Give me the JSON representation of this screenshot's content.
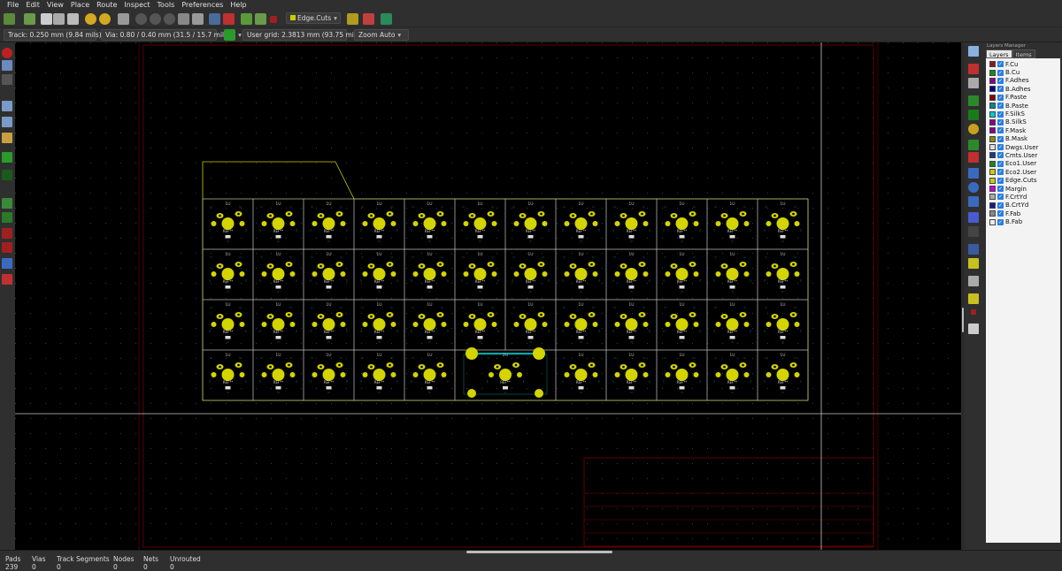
{
  "menu": [
    "File",
    "Edit",
    "View",
    "Place",
    "Route",
    "Inspect",
    "Tools",
    "Preferences",
    "Help"
  ],
  "toolbar": {
    "active_layer": "Edge.Cuts",
    "track": "Track: 0.250 mm (9.84 mils) *",
    "via": "Via: 0.80 / 0.40 mm (31.5 / 15.7 mils) *",
    "grid": "User grid: 2.3813 mm (93.75 mils)",
    "zoom": "Zoom Auto"
  },
  "layers_panel": {
    "title": "Layers Manager",
    "tabs": [
      "Layers",
      "Items"
    ],
    "layers": [
      {
        "name": "F.Cu",
        "color": "#8b1a1a"
      },
      {
        "name": "B.Cu",
        "color": "#1a8b1a"
      },
      {
        "name": "F.Adhes",
        "color": "#8b008b"
      },
      {
        "name": "B.Adhes",
        "color": "#00008b"
      },
      {
        "name": "F.Paste",
        "color": "#8b0000"
      },
      {
        "name": "B.Paste",
        "color": "#008b8b"
      },
      {
        "name": "F.SilkS",
        "color": "#00cccc"
      },
      {
        "name": "B.SilkS",
        "color": "#8b008b"
      },
      {
        "name": "F.Mask",
        "color": "#8b008b"
      },
      {
        "name": "B.Mask",
        "color": "#8b8b00"
      },
      {
        "name": "Dwgs.User",
        "color": "#dddddd"
      },
      {
        "name": "Cmts.User",
        "color": "#1a3a8b"
      },
      {
        "name": "Eco1.User",
        "color": "#1a8b1a"
      },
      {
        "name": "Eco2.User",
        "color": "#cccc00"
      },
      {
        "name": "Edge.Cuts",
        "color": "#cccc00"
      },
      {
        "name": "Margin",
        "color": "#cc00cc"
      },
      {
        "name": "F.CrtYd",
        "color": "#aaaaaa"
      },
      {
        "name": "B.CrtYd",
        "color": "#1a1a8b"
      },
      {
        "name": "F.Fab",
        "color": "#888888"
      },
      {
        "name": "B.Fab",
        "color": "#eeeeee"
      }
    ]
  },
  "status": {
    "pads_label": "Pads",
    "pads": "239",
    "vias_label": "Vias",
    "vias": "0",
    "tracks_label": "Track Segments",
    "tracks": "0",
    "nodes_label": "Nodes",
    "nodes": "0",
    "nets_label": "Nets",
    "nets": "0",
    "unrouted_label": "Unrouted",
    "unrouted": "0"
  },
  "board": {
    "key_silk_label": "1U",
    "key_ref_label": "REF**",
    "wide_key_label": "2U",
    "rows": 4,
    "cols": 12,
    "colors": {
      "edge": "#cccc00",
      "pad": "#d4d400",
      "frame": "#c8c8c8",
      "drawing_border": "#7a0000",
      "silk_cyan": "#00aaaa"
    }
  }
}
